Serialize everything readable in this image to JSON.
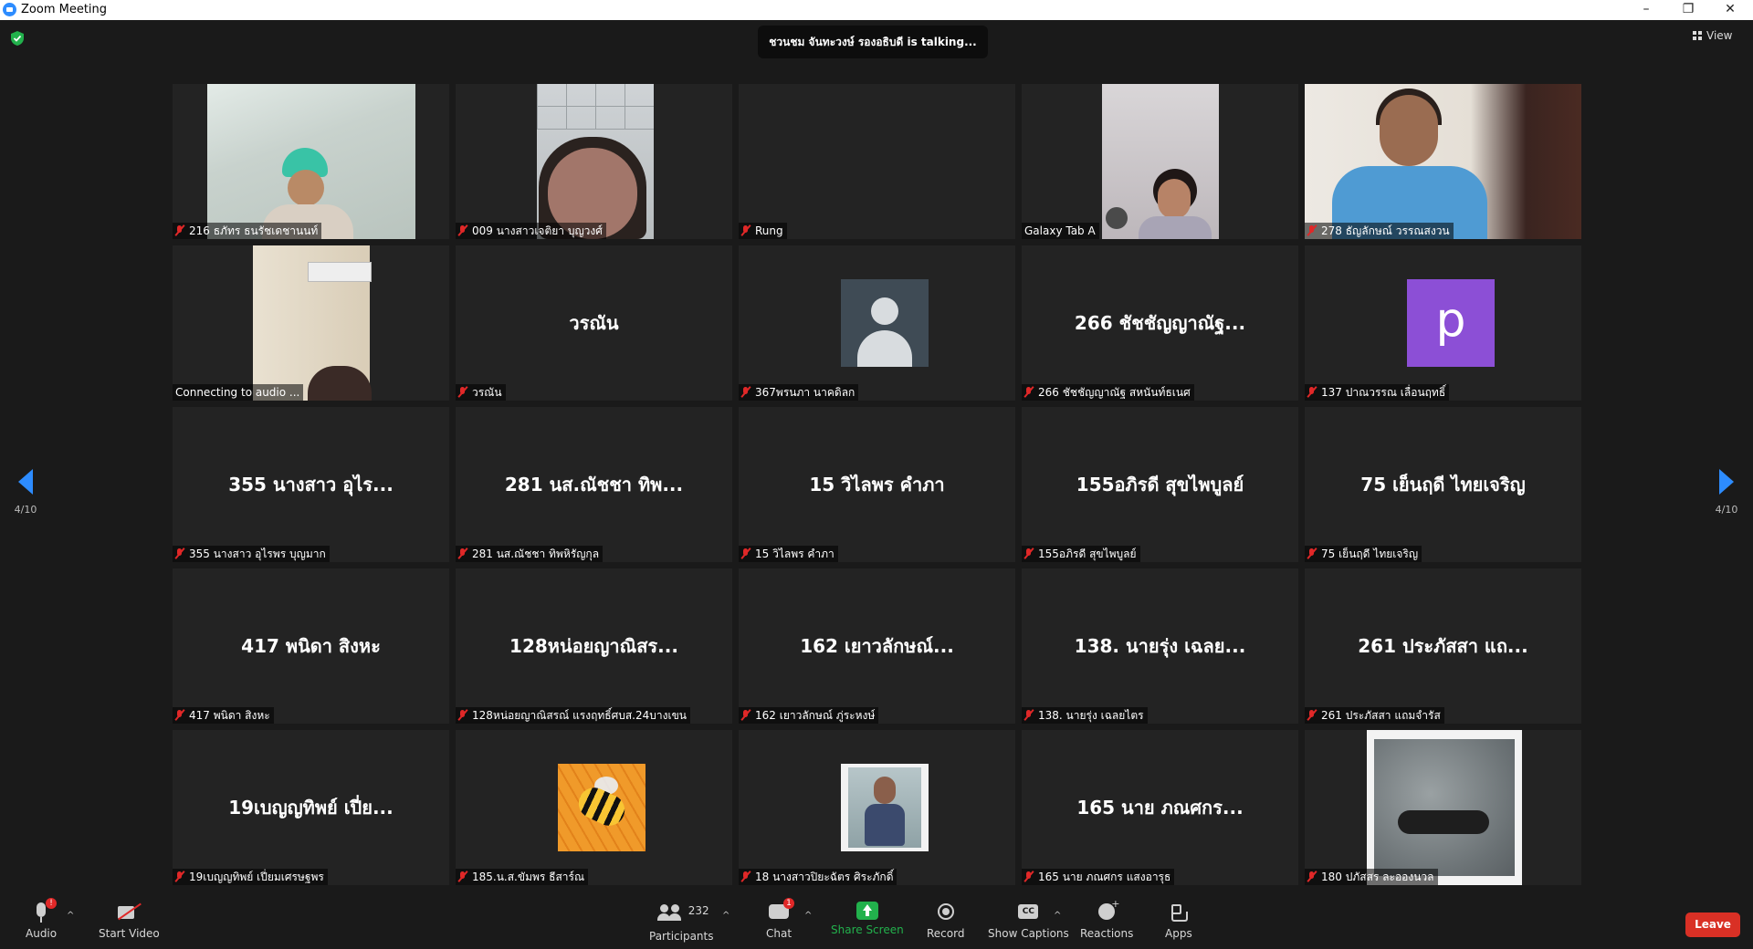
{
  "window": {
    "title": "Zoom Meeting",
    "minimize": "–",
    "restore": "❐",
    "close": "✕"
  },
  "topbar": {
    "talking": "ชวนชม จันทะวงษ์ รองอธิบดี is talking...",
    "view_label": "View"
  },
  "pagination": {
    "left_page": "4/10",
    "right_page": "4/10"
  },
  "tiles": [
    {
      "type": "video",
      "video": "v-hospital",
      "label": "216 ธภัทร ธนรัชเดชานนท์",
      "muted": true
    },
    {
      "type": "video",
      "video": "v-ceiling",
      "label": "009 นางสาวเจติยา บุญวงศ์",
      "muted": true
    },
    {
      "type": "blank",
      "label": "Rung",
      "muted": true
    },
    {
      "type": "video",
      "video": "v-tab",
      "label": "Galaxy Tab A",
      "muted": false
    },
    {
      "type": "video",
      "video": "v-woman",
      "label": "278 ธัญลักษณ์ วรรณสงวน",
      "muted": true
    },
    {
      "type": "video",
      "video": "v-room",
      "label": "Connecting to audio ...",
      "muted": false
    },
    {
      "type": "name",
      "display_name": "วรณัน",
      "label": "วรณัน",
      "muted": true
    },
    {
      "type": "avatar",
      "avatar": "default",
      "label": "367พรนภา นาคดิลก",
      "muted": true
    },
    {
      "type": "name",
      "display_name": "266 ชัชชัญญาณัฐ...",
      "label": "266 ชัชชัญญาณัฐ สหนันท์ธเนศ",
      "muted": true
    },
    {
      "type": "avatar",
      "avatar": "letter",
      "letter": "p",
      "label": "137 ปาณวรรณ เลื่อนฤทธิ์",
      "muted": true
    },
    {
      "type": "name",
      "display_name": "355 นางสาว อุไร...",
      "label": "355 นางสาว อุไรพร บุญมาก",
      "muted": true
    },
    {
      "type": "name",
      "display_name": "281 นส.ณัชชา ทิพ...",
      "label": "281 นส.ณัชชา ทิพหิรัญกุล",
      "muted": true
    },
    {
      "type": "name",
      "display_name": "15 วิไลพร คำภา",
      "label": "15 วิไลพร คำภา",
      "muted": true
    },
    {
      "type": "name",
      "display_name": "155อภิรดี สุขไพบูลย์",
      "label": "155อภิรดี สุขไพบูลย์",
      "muted": true
    },
    {
      "type": "name",
      "display_name": "75 เย็นฤดี ไทยเจริญ",
      "label": "75 เย็นฤดี ไทยเจริญ",
      "muted": true
    },
    {
      "type": "name",
      "display_name": "417 พนิดา สิงหะ",
      "label": "417 พนิดา สิงหะ",
      "muted": true
    },
    {
      "type": "name",
      "display_name": "128หน่อยญาณิสร...",
      "label": "128หน่อยญาณิสรณ์ แรงฤทธิ์ศบส.24บางเขน",
      "muted": true
    },
    {
      "type": "name",
      "display_name": "162 เยาวลักษณ์...",
      "label": "162 เยาวลักษณ์ ภู่ระหงษ์",
      "muted": true
    },
    {
      "type": "name",
      "display_name": "138. นายรุ่ง เฉลย...",
      "label": "138. นายรุ่ง เฉลยไตร",
      "muted": true
    },
    {
      "type": "name",
      "display_name": "261 ประภัสสา แถ...",
      "label": "261 ประภัสสา แถมจำรัส",
      "muted": true
    },
    {
      "type": "name",
      "display_name": "19เบญญทิพย์ เปี่ย...",
      "label": "19เบญญทิพย์ เปี่ยมเศรษฐพร",
      "muted": true
    },
    {
      "type": "avatar",
      "avatar": "bee",
      "label": "185.น.ส.ขัมพร ธีสาร์ณ",
      "muted": true
    },
    {
      "type": "avatar",
      "avatar": "photo",
      "label": "18 นางสาวปิยะฉัตร ศิระภักดิ์",
      "muted": true
    },
    {
      "type": "name",
      "display_name": "165 นาย ภณศกร...",
      "label": "165 นาย ภณศกร แสงอารุธ",
      "muted": true
    },
    {
      "type": "video",
      "video": "v-stone",
      "label": "180 ปภัสสร ละอองนวล",
      "muted": true
    }
  ],
  "toolbar": {
    "audio": "Audio",
    "audio_badge": "!",
    "start_video": "Start Video",
    "participants": "Participants",
    "participants_count": "232",
    "chat": "Chat",
    "chat_badge": "1",
    "share_screen": "Share Screen",
    "record": "Record",
    "show_captions": "Show Captions",
    "reactions": "Reactions",
    "apps": "Apps",
    "leave": "Leave",
    "caret": "^"
  },
  "colors": {
    "accent": "#2d8cff",
    "share_green": "#22b14c",
    "leave_red": "#d93025",
    "mute_red": "#e02828"
  }
}
